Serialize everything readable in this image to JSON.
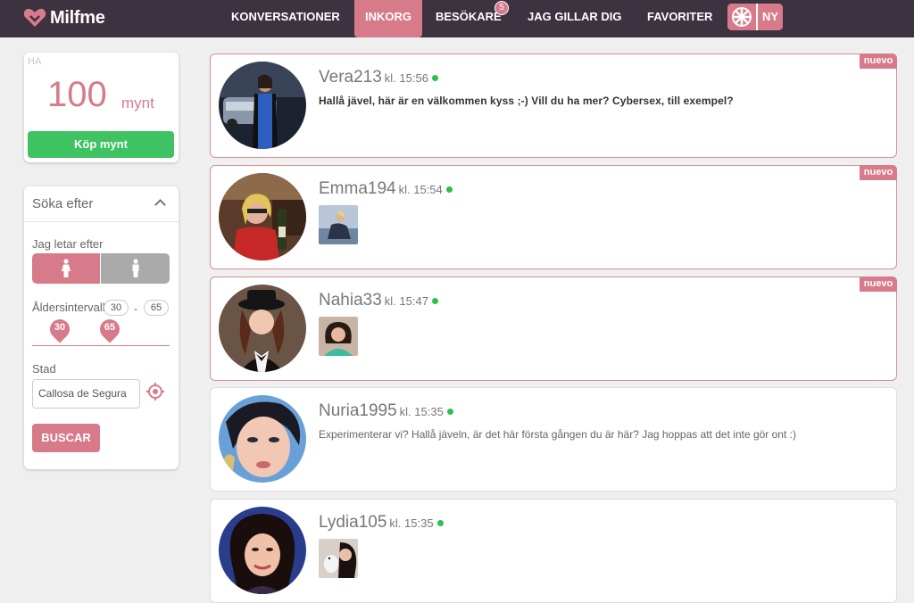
{
  "brand": {
    "name": "Milfme"
  },
  "nav": {
    "items": [
      {
        "label": "KONVERSATIONER"
      },
      {
        "label": "INKORG"
      },
      {
        "label": "BESÖKARE",
        "badge": "5"
      },
      {
        "label": "JAG GILLAR DIG"
      },
      {
        "label": "FAVORITER"
      }
    ],
    "active": "INKORG",
    "new_toggle": {
      "label": "NY",
      "icon": "roulette-wheel-icon"
    }
  },
  "coins": {
    "corner_label": "HA",
    "amount": "100",
    "unit": "mynt",
    "buy_label": "Köp mynt"
  },
  "search": {
    "title": "Söka efter",
    "looking_for_label": "Jag letar efter",
    "gender_options": [
      {
        "icon": "female-icon",
        "selected": true
      },
      {
        "icon": "male-icon",
        "selected": false
      }
    ],
    "age_label": "Åldersintervall",
    "age_min": "30",
    "age_max": "65",
    "age_separator": "-",
    "city_label": "Stad",
    "city_value": "Callosa de Segura",
    "submit_label": "BUSCAR"
  },
  "conversations": [
    {
      "name": "Vera213",
      "time": "kl. 15:56",
      "online": true,
      "message": "Hallå jävel, här är en välkommen kyss ;-) Vill du ha mer? Cybersex, till exempel?",
      "new_badge": "nuevo",
      "unread": true
    },
    {
      "name": "Emma194",
      "time": "kl. 15:54",
      "online": true,
      "has_image": true,
      "new_badge": "nuevo",
      "unread": true
    },
    {
      "name": "Nahia33",
      "time": "kl. 15:47",
      "online": true,
      "has_image": true,
      "new_badge": "nuevo",
      "unread": true
    },
    {
      "name": "Nuria1995",
      "time": "kl. 15:35",
      "online": true,
      "message": "Experimenterar vi? Hallå jäveln, är det här första gången du är här? Jag hoppas att det inte gör ont :)",
      "unread": false
    },
    {
      "name": "Lydia105",
      "time": "kl. 15:35",
      "online": true,
      "has_image": true,
      "unread": false
    }
  ],
  "colors": {
    "header": "#3c3240",
    "accent": "#d77a8a",
    "buy": "#3fc262",
    "online": "#2fbf4e"
  }
}
